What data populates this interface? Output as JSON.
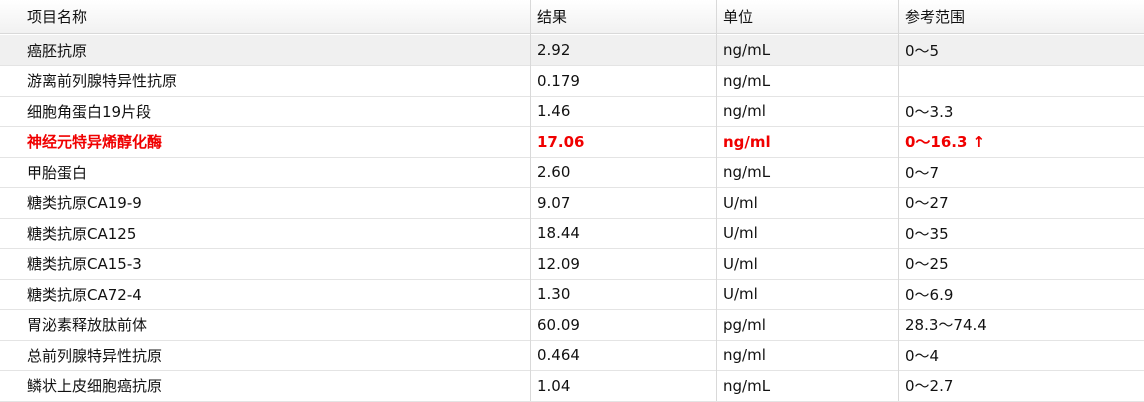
{
  "table": {
    "headers": {
      "name": "项目名称",
      "result": "结果",
      "unit": "单位",
      "reference": "参考范围"
    },
    "rows": [
      {
        "name": "癌胚抗原",
        "result": "2.92",
        "unit": "ng/mL",
        "reference": "0～5",
        "flag": "",
        "selected": true
      },
      {
        "name": "游离前列腺特异性抗原",
        "result": "0.179",
        "unit": "ng/mL",
        "reference": "",
        "flag": "",
        "selected": false
      },
      {
        "name": "细胞角蛋白19片段",
        "result": "1.46",
        "unit": "ng/ml",
        "reference": "0～3.3",
        "flag": "",
        "selected": false
      },
      {
        "name": "神经元特异烯醇化酶",
        "result": "17.06",
        "unit": "ng/ml",
        "reference": "0～16.3",
        "flag": "↑",
        "selected": false
      },
      {
        "name": "甲胎蛋白",
        "result": "2.60",
        "unit": "ng/mL",
        "reference": "0～7",
        "flag": "",
        "selected": false
      },
      {
        "name": "糖类抗原CA19-9",
        "result": "9.07",
        "unit": "U/ml",
        "reference": "0～27",
        "flag": "",
        "selected": false
      },
      {
        "name": "糖类抗原CA125",
        "result": "18.44",
        "unit": "U/ml",
        "reference": "0～35",
        "flag": "",
        "selected": false
      },
      {
        "name": "糖类抗原CA15-3",
        "result": "12.09",
        "unit": "U/ml",
        "reference": "0～25",
        "flag": "",
        "selected": false
      },
      {
        "name": "糖类抗原CA72-4",
        "result": "1.30",
        "unit": "U/ml",
        "reference": "0～6.9",
        "flag": "",
        "selected": false
      },
      {
        "name": "胃泌素释放肽前体",
        "result": "60.09",
        "unit": "pg/ml",
        "reference": "28.3～74.4",
        "flag": "",
        "selected": false
      },
      {
        "name": "总前列腺特异性抗原",
        "result": "0.464",
        "unit": "ng/ml",
        "reference": "0～4",
        "flag": "",
        "selected": false
      },
      {
        "name": "鳞状上皮细胞癌抗原",
        "result": "1.04",
        "unit": "ng/mL",
        "reference": "0～2.7",
        "flag": "",
        "selected": false
      }
    ]
  },
  "colors": {
    "abnormal_text": "#f00000",
    "selected_row_bg": "#f0f0f0",
    "grid_line": "#d9d9d9"
  },
  "icons": {
    "abnormal_high": "arrow-up-icon"
  }
}
